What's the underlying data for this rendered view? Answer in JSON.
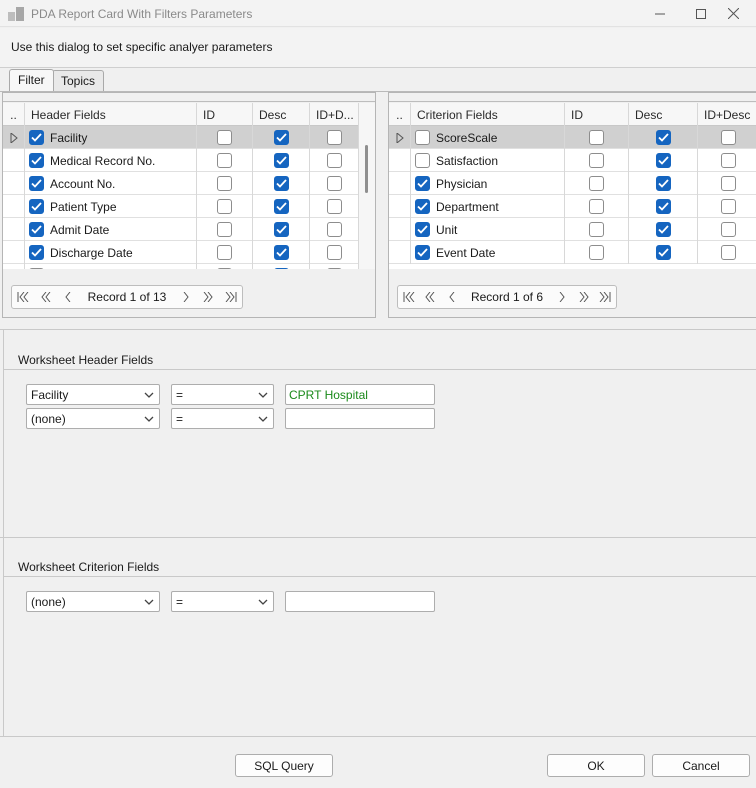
{
  "window": {
    "title": "PDA Report Card With Filters Parameters"
  },
  "info": "Use this dialog to set specific analyer parameters",
  "tabs": [
    {
      "label": "Filter",
      "active": true
    },
    {
      "label": "Topics",
      "active": false
    }
  ],
  "header_grid": {
    "columns": [
      "..",
      "Header Fields",
      "ID",
      "Desc",
      "ID+D..."
    ],
    "rows": [
      {
        "selected": true,
        "check": true,
        "name": "Facility",
        "id": false,
        "desc": true,
        "iddesc": false
      },
      {
        "selected": false,
        "check": true,
        "name": "Medical Record No.",
        "id": false,
        "desc": true,
        "iddesc": false
      },
      {
        "selected": false,
        "check": true,
        "name": "Account No.",
        "id": false,
        "desc": true,
        "iddesc": false
      },
      {
        "selected": false,
        "check": true,
        "name": "Patient Type",
        "id": false,
        "desc": true,
        "iddesc": false
      },
      {
        "selected": false,
        "check": true,
        "name": "Admit Date",
        "id": false,
        "desc": true,
        "iddesc": false
      },
      {
        "selected": false,
        "check": true,
        "name": "Discharge Date",
        "id": false,
        "desc": true,
        "iddesc": false
      },
      {
        "selected": false,
        "check": false,
        "name": "Review Date",
        "id": false,
        "desc": true,
        "iddesc": false
      }
    ],
    "record_text": "Record 1 of 13"
  },
  "criterion_grid": {
    "columns": [
      "..",
      "Criterion Fields",
      "ID",
      "Desc",
      "ID+Desc"
    ],
    "rows": [
      {
        "selected": true,
        "check": false,
        "name": "ScoreScale",
        "id": false,
        "desc": true,
        "iddesc": false
      },
      {
        "selected": false,
        "check": false,
        "name": "Satisfaction",
        "id": false,
        "desc": true,
        "iddesc": false
      },
      {
        "selected": false,
        "check": true,
        "name": "Physician",
        "id": false,
        "desc": true,
        "iddesc": false
      },
      {
        "selected": false,
        "check": true,
        "name": "Department",
        "id": false,
        "desc": true,
        "iddesc": false
      },
      {
        "selected": false,
        "check": true,
        "name": "Unit",
        "id": false,
        "desc": true,
        "iddesc": false
      },
      {
        "selected": false,
        "check": true,
        "name": "Event Date",
        "id": false,
        "desc": true,
        "iddesc": false
      }
    ],
    "record_text": "Record 1 of 6"
  },
  "worksheet_header": {
    "label": "Worksheet Header Fields",
    "rows": [
      {
        "field": "Facility",
        "op": "=",
        "value": "CPRT Hospital"
      },
      {
        "field": "(none)",
        "op": "=",
        "value": ""
      }
    ]
  },
  "worksheet_criterion": {
    "label": "Worksheet Criterion Fields",
    "rows": [
      {
        "field": "(none)",
        "op": "=",
        "value": ""
      }
    ]
  },
  "buttons": {
    "sql": "SQL Query",
    "ok": "OK",
    "cancel": "Cancel"
  },
  "colors": {
    "check_blue": "#1565c0",
    "value_green": "#1a8a1a"
  }
}
